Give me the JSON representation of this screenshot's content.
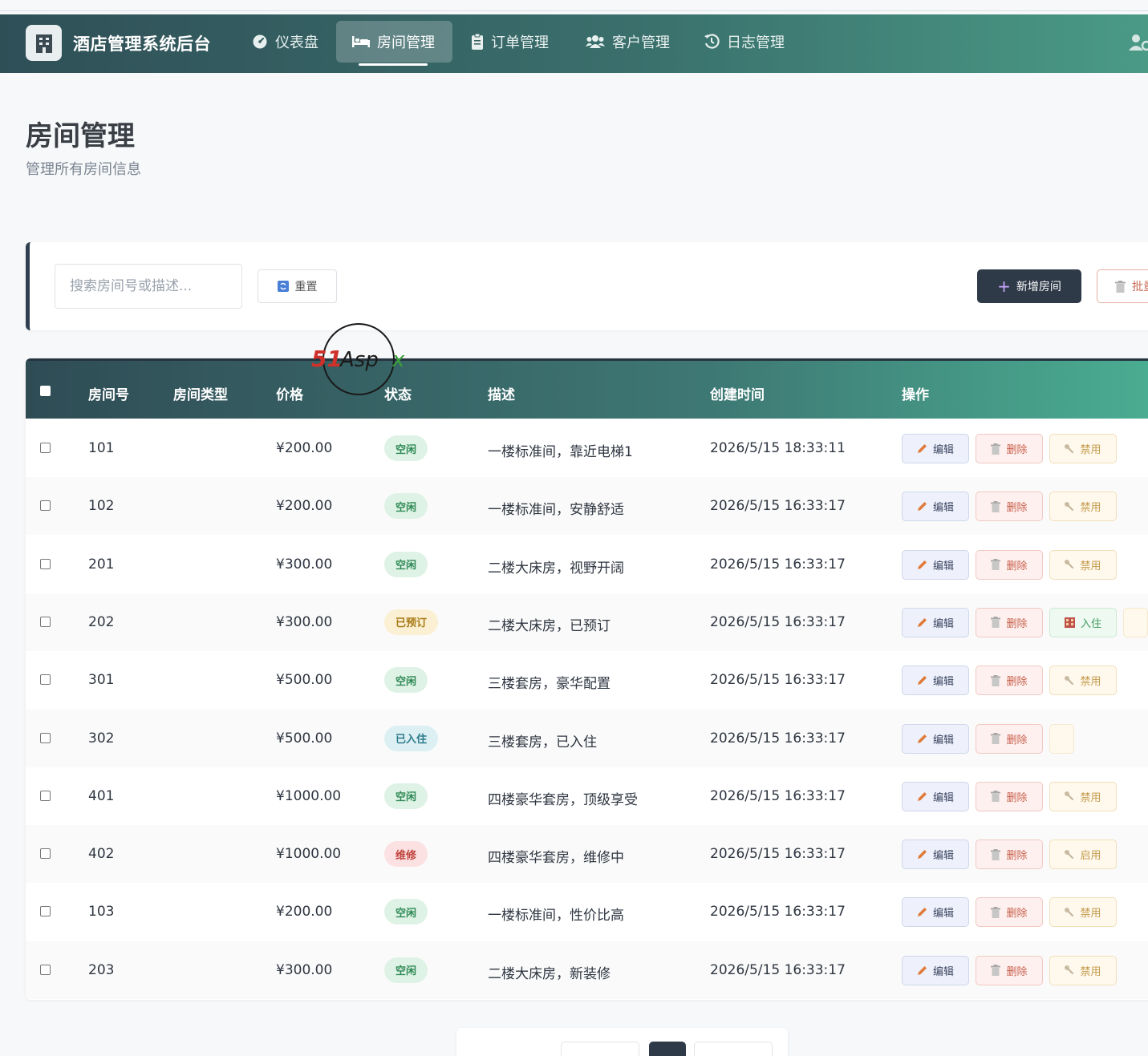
{
  "app": {
    "title": "酒店管理系统后台"
  },
  "nav": {
    "items": [
      {
        "label": "仪表盘",
        "icon": "dashboard-icon"
      },
      {
        "label": "房间管理",
        "icon": "bed-icon",
        "active": true
      },
      {
        "label": "订单管理",
        "icon": "clipboard-icon"
      },
      {
        "label": "客户管理",
        "icon": "users-icon"
      },
      {
        "label": "日志管理",
        "icon": "history-icon"
      }
    ]
  },
  "page": {
    "title": "房间管理",
    "subtitle": "管理所有房间信息"
  },
  "toolbar": {
    "search_placeholder": "搜索房间号或描述...",
    "reset_label": "重置",
    "add_label": "新增房间",
    "batch_label": "批量删除"
  },
  "table": {
    "headers": {
      "room_no": "房间号",
      "room_type": "房间类型",
      "price": "价格",
      "status": "状态",
      "description": "描述",
      "created": "创建时间",
      "actions": "操作"
    },
    "action_labels": {
      "edit": "编辑",
      "delete": "删除",
      "disable": "禁用",
      "enable": "启用",
      "checkin": "入住"
    },
    "rows": [
      {
        "room_no": "101",
        "room_type": "",
        "price": "¥200.00",
        "status": "空闲",
        "description": "一楼标准间，靠近电梯1",
        "created": "2026/5/15 18:33:11"
      },
      {
        "room_no": "102",
        "room_type": "",
        "price": "¥200.00",
        "status": "空闲",
        "description": "一楼标准间，安静舒适",
        "created": "2026/5/15 16:33:17"
      },
      {
        "room_no": "201",
        "room_type": "",
        "price": "¥300.00",
        "status": "空闲",
        "description": "二楼大床房，视野开阔",
        "created": "2026/5/15 16:33:17"
      },
      {
        "room_no": "202",
        "room_type": "",
        "price": "¥300.00",
        "status": "已预订",
        "description": "二楼大床房，已预订",
        "created": "2026/5/15 16:33:17"
      },
      {
        "room_no": "301",
        "room_type": "",
        "price": "¥500.00",
        "status": "空闲",
        "description": "三楼套房，豪华配置",
        "created": "2026/5/15 16:33:17"
      },
      {
        "room_no": "302",
        "room_type": "",
        "price": "¥500.00",
        "status": "已入住",
        "description": "三楼套房，已入住",
        "created": "2026/5/15 16:33:17"
      },
      {
        "room_no": "401",
        "room_type": "",
        "price": "¥1000.00",
        "status": "空闲",
        "description": "四楼豪华套房，顶级享受",
        "created": "2026/5/15 16:33:17"
      },
      {
        "room_no": "402",
        "room_type": "",
        "price": "¥1000.00",
        "status": "维修",
        "description": "四楼豪华套房，维修中",
        "created": "2026/5/15 16:33:17"
      },
      {
        "room_no": "103",
        "room_type": "",
        "price": "¥200.00",
        "status": "空闲",
        "description": "一楼标准间，性价比高",
        "created": "2026/5/15 16:33:17"
      },
      {
        "room_no": "203",
        "room_type": "",
        "price": "¥300.00",
        "status": "空闲",
        "description": "二楼大床房，新装修",
        "created": "2026/5/15 16:33:17"
      }
    ]
  },
  "watermark": {
    "text": "51Aspx"
  },
  "colors": {
    "primary": "#2e3a48",
    "nav_start": "#2f4f57",
    "nav_end": "#4a9a86",
    "free": "#2f8a55",
    "booked": "#a87a15",
    "occupied": "#2c7a8c",
    "repair": "#c0443f"
  }
}
